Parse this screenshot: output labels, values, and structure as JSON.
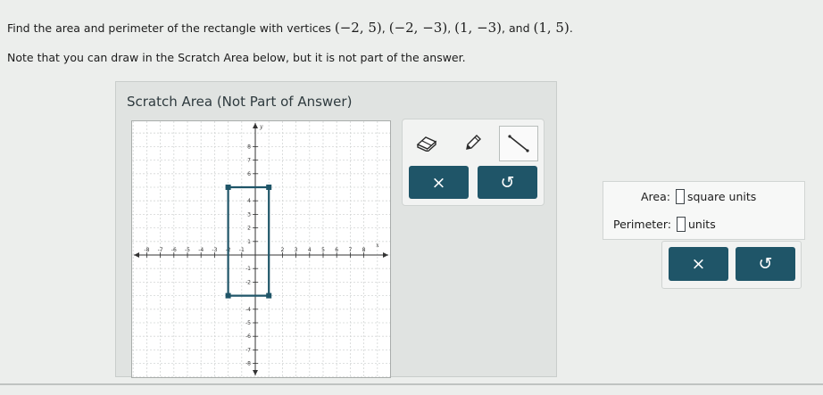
{
  "question": {
    "line1_prefix": "Find the area and perimeter of the rectangle with vertices ",
    "vertices": [
      "(−2,  5)",
      "(−2,  −3)",
      "(1,  −3)",
      "(1,  5)"
    ],
    "separator": ", ",
    "and_word": ", and ",
    "line1_end": ".",
    "line2": "Note that you can draw in the Scratch Area below, but it is not part of the answer."
  },
  "scratch": {
    "title": "Scratch Area (Not Part of Answer)",
    "graph": {
      "x_tick_labels": [
        "-8",
        "-7",
        "-6",
        "-5",
        "-4",
        "-3",
        "-2",
        "-1",
        "2",
        "3",
        "4",
        "5",
        "6",
        "7",
        "8"
      ],
      "y_tick_labels": [
        "8",
        "7",
        "6",
        "4",
        "3",
        "2",
        "1",
        "-1",
        "-2",
        "-4",
        "-5",
        "-6",
        "-7",
        "-8"
      ],
      "x_axis_label": "x",
      "y_axis_label": "y",
      "rectangle_vertices": [
        [
          -2,
          5
        ],
        [
          -2,
          -3
        ],
        [
          1,
          -3
        ],
        [
          1,
          5
        ]
      ],
      "rectangle_color": "#1f5568"
    },
    "tools": [
      {
        "name": "eraser-icon"
      },
      {
        "name": "pencil-icon"
      },
      {
        "name": "line-tool-icon"
      }
    ],
    "clear_label": "×",
    "undo_label": "↺"
  },
  "answer": {
    "area_label": "Area:",
    "area_units": "square units",
    "perimeter_label": "Perimeter:",
    "perimeter_units": "units",
    "clear_label": "×",
    "undo_label": "↺"
  }
}
